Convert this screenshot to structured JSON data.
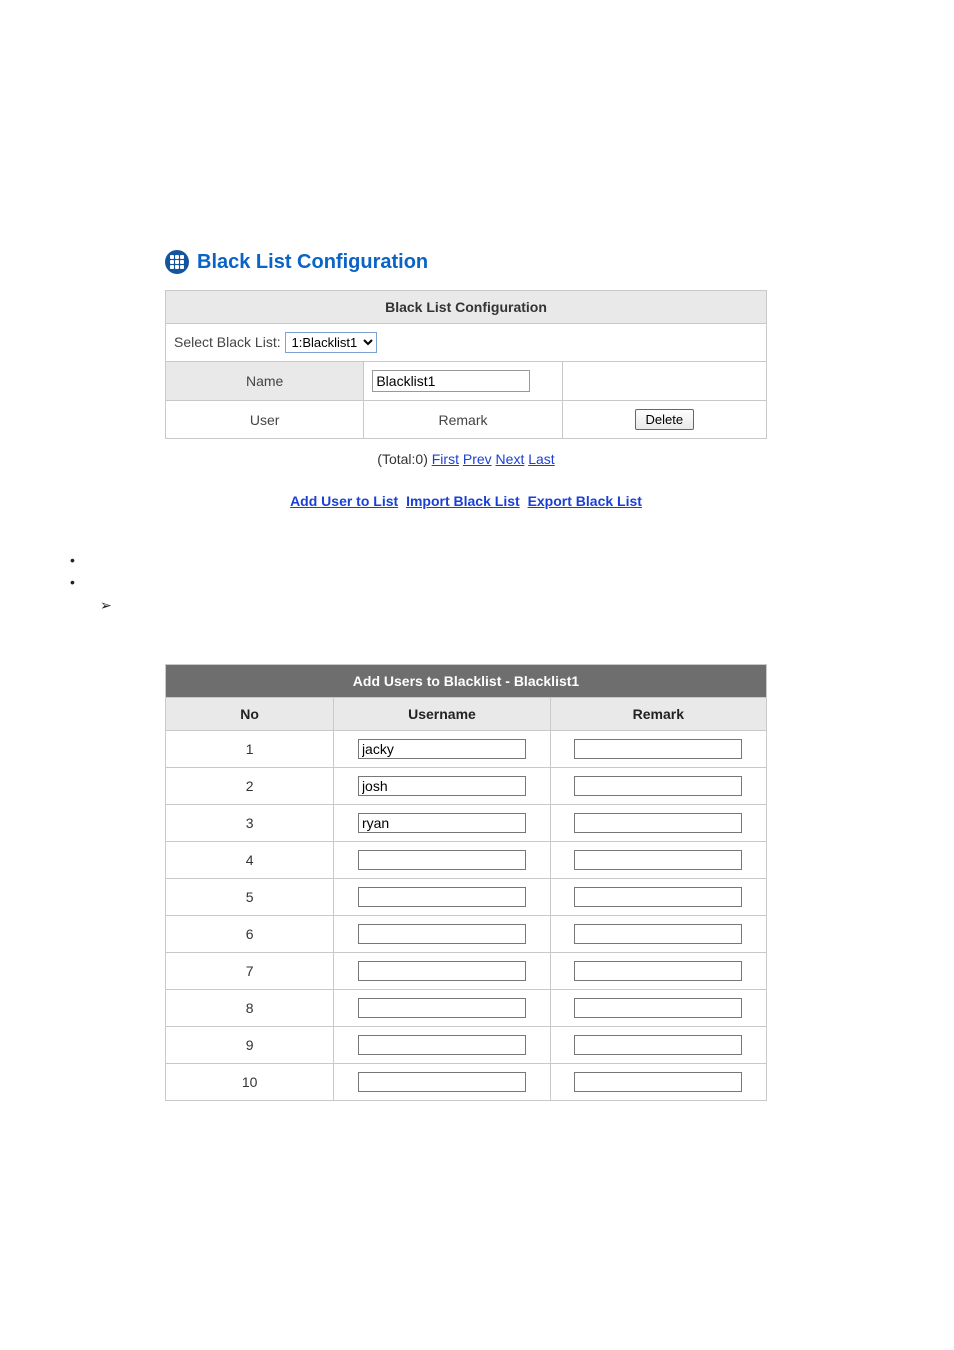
{
  "header": {
    "title": "Black List Configuration"
  },
  "config": {
    "panel_title": "Black List Configuration",
    "select_label": "Select Black List:",
    "select_value": "1:Blacklist1",
    "name_label": "Name",
    "name_value": "Blacklist1",
    "cols": {
      "user": "User",
      "remark": "Remark"
    },
    "delete_label": "Delete"
  },
  "pager": {
    "total_prefix": "(Total:0)",
    "first": "First",
    "prev": "Prev",
    "next": "Next",
    "last": "Last"
  },
  "actions": {
    "add": "Add User to List",
    "import": "Import Black List",
    "export": "Export Black List"
  },
  "add_panel": {
    "title": "Add Users to Blacklist - Blacklist1",
    "cols": {
      "no": "No",
      "username": "Username",
      "remark": "Remark"
    },
    "rows": [
      {
        "no": "1",
        "username": "jacky",
        "remark": ""
      },
      {
        "no": "2",
        "username": "josh",
        "remark": ""
      },
      {
        "no": "3",
        "username": "ryan",
        "remark": ""
      },
      {
        "no": "4",
        "username": "",
        "remark": ""
      },
      {
        "no": "5",
        "username": "",
        "remark": ""
      },
      {
        "no": "6",
        "username": "",
        "remark": ""
      },
      {
        "no": "7",
        "username": "",
        "remark": ""
      },
      {
        "no": "8",
        "username": "",
        "remark": ""
      },
      {
        "no": "9",
        "username": "",
        "remark": ""
      },
      {
        "no": "10",
        "username": "",
        "remark": ""
      }
    ]
  }
}
